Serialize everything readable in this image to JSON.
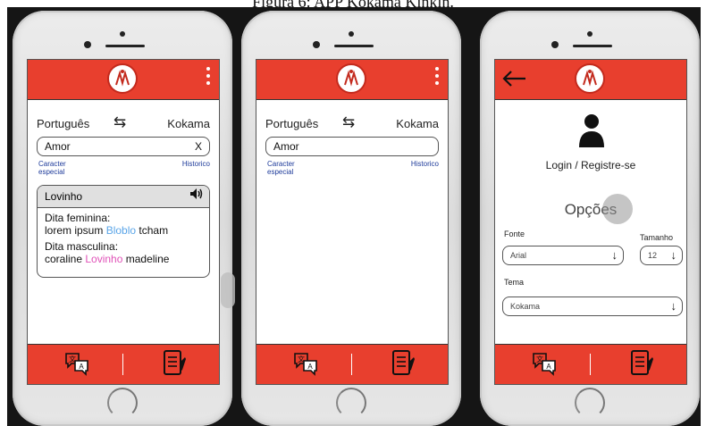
{
  "caption": "Figura 6: APP Kokama Kinkin.",
  "screen1": {
    "source_lang": "Português",
    "swap_symbol": "⇆",
    "target_lang": "Kokama",
    "search_value": "Amor",
    "clear_label": "X",
    "special_char_label": "Caracter especial",
    "history_label": "Historico",
    "result_word": "Lovinho",
    "feminine_title": "Dita feminina:",
    "feminine_pre": "lorem ipsum ",
    "feminine_highlight": "Bloblo",
    "feminine_post": " tcham",
    "masculine_title": "Dita masculina:",
    "masculine_pre": "coraline ",
    "masculine_highlight": "Lovinho",
    "masculine_post": " madeline"
  },
  "screen2": {
    "source_lang": "Português",
    "swap_symbol": "⇆",
    "target_lang": "Kokama",
    "search_value": "Amor",
    "special_char_label": "Caracter especial",
    "history_label": "Historico"
  },
  "screen3": {
    "login_label": "Login / Registre-se",
    "options_title": "Opções",
    "font_label": "Fonte",
    "font_value": "Arial",
    "size_label": "Tamanho",
    "size_value": "12",
    "theme_label": "Tema",
    "theme_value": "Kokama"
  },
  "icons": {
    "menu": "kebab-menu-icon",
    "back": "arrow-left-icon",
    "translate": "translate-icon",
    "dictionary": "notebook-icon",
    "speaker": "speaker-icon",
    "user": "user-icon"
  },
  "colors": {
    "brand": "#e83f2e",
    "highlight_blue": "#5aa5e8",
    "highlight_pink": "#e052b8"
  }
}
